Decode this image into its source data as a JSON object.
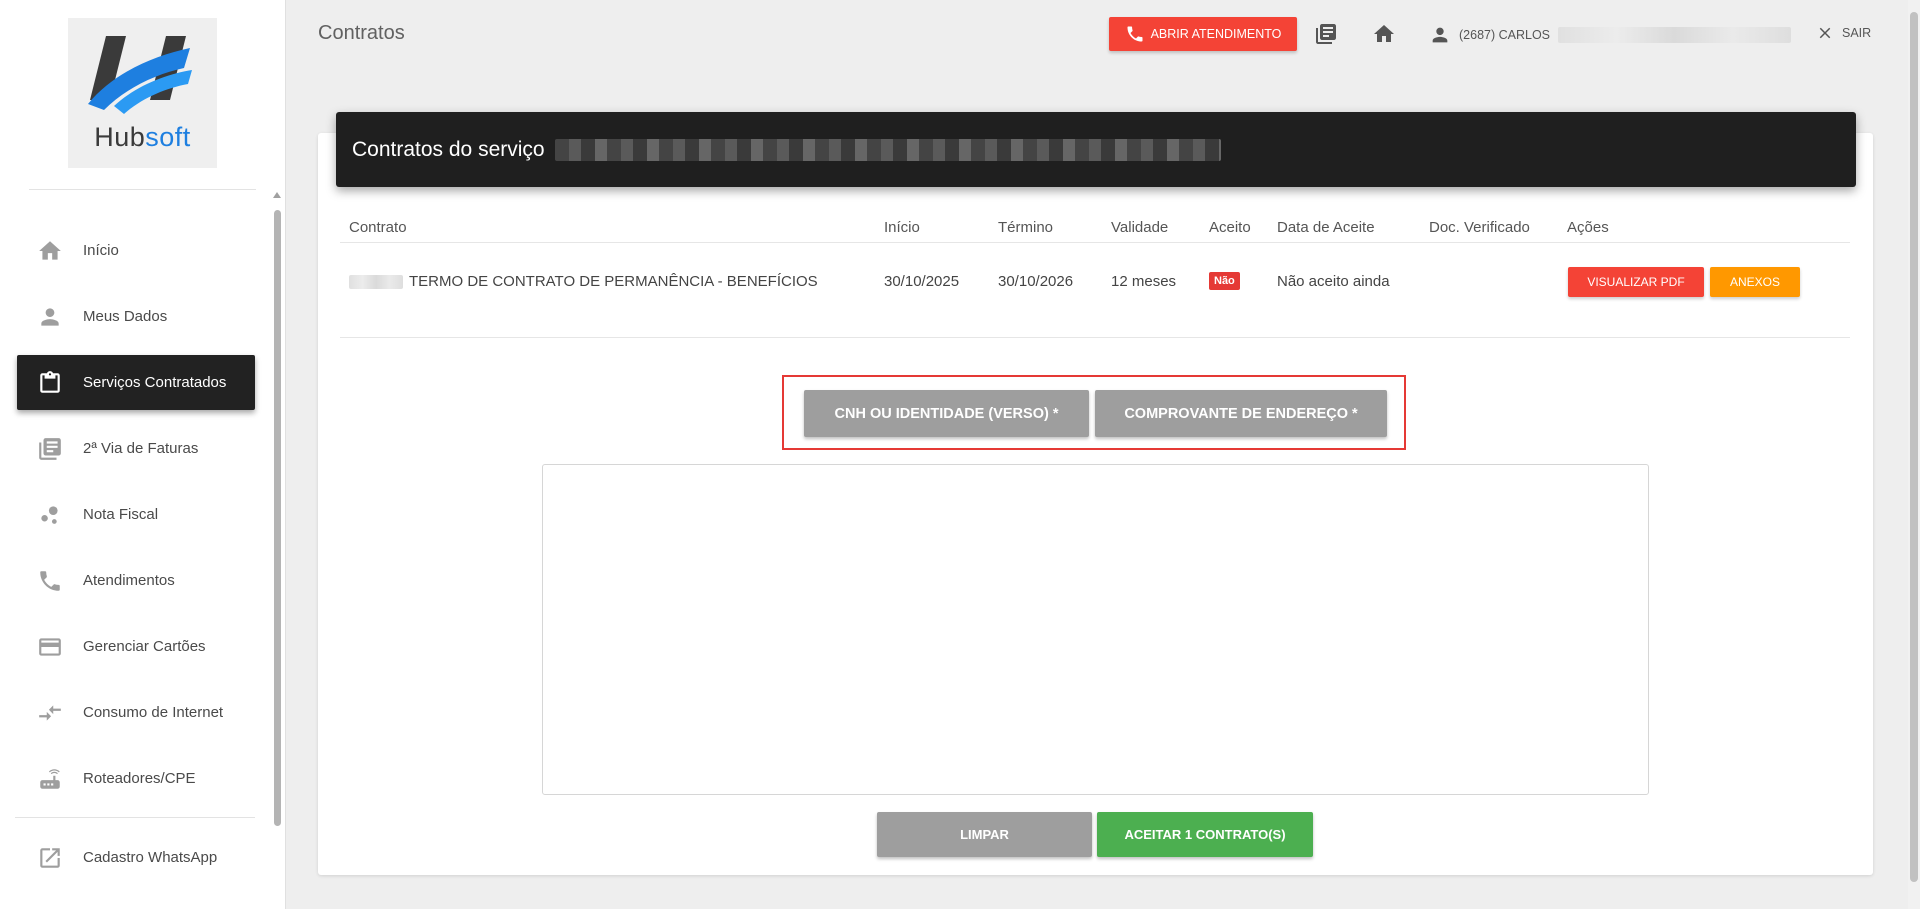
{
  "app": {
    "brand_hub": "Hub",
    "brand_soft": "soft"
  },
  "sidebar": {
    "items": [
      {
        "label": "Início",
        "icon": "home-icon"
      },
      {
        "label": "Meus Dados",
        "icon": "person-icon"
      },
      {
        "label": "Serviços Contratados",
        "icon": "clipboard-icon",
        "active": true
      },
      {
        "label": "2ª Via de Faturas",
        "icon": "invoices-icon"
      },
      {
        "label": "Nota Fiscal",
        "icon": "bubbles-icon"
      },
      {
        "label": "Atendimentos",
        "icon": "phone-icon"
      },
      {
        "label": "Gerenciar Cartões",
        "icon": "credit-card-icon"
      },
      {
        "label": "Consumo de Internet",
        "icon": "arrows-icon"
      },
      {
        "label": "Roteadores/CPE",
        "icon": "router-icon"
      },
      {
        "label": "Cadastro WhatsApp",
        "icon": "external-link-icon"
      }
    ]
  },
  "header": {
    "title": "Contratos",
    "open_ticket_label": "ABRIR ATENDIMENTO",
    "user_label": "(2687) CARLOS",
    "logout_label": "SAIR"
  },
  "card": {
    "title": "Contratos do serviço",
    "columns": [
      "Contrato",
      "Início",
      "Término",
      "Validade",
      "Aceito",
      "Data de Aceite",
      "Doc. Verificado",
      "Ações"
    ],
    "rows": [
      {
        "contract": "TERMO DE CONTRATO DE PERMANÊNCIA - BENEFÍCIOS",
        "start": "30/10/2025",
        "end": "30/10/2026",
        "validity": "12 meses",
        "accepted": "Não",
        "accept_date": "Não aceito ainda",
        "doc_verified": "",
        "pdf_label": "VISUALIZAR PDF",
        "attachments_label": "ANEXOS"
      }
    ],
    "doc_buttons": {
      "id_back": "CNH OU IDENTIDADE (VERSO) *",
      "address_proof": "COMPROVANTE DE ENDEREÇO *"
    },
    "clear_label": "LIMPAR",
    "accept_label": "ACEITAR 1 CONTRATO(S)"
  },
  "colors": {
    "accent_red": "#f44336",
    "accent_orange": "#ff9800",
    "accent_green": "#4caf50",
    "brand_blue": "#1e7fe0",
    "sidebar_active": "#222222"
  }
}
